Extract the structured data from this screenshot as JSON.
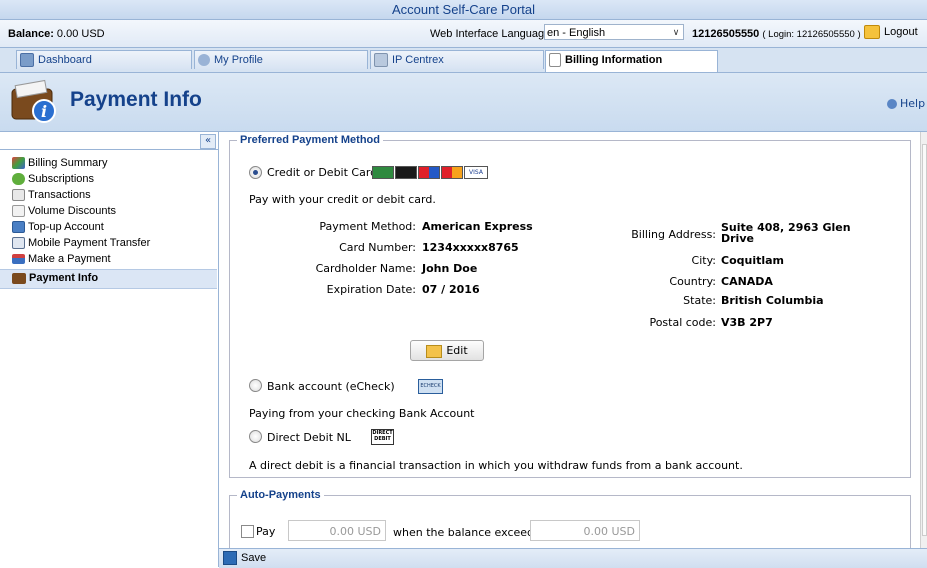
{
  "app": {
    "title": "Account Self-Care Portal"
  },
  "infobar": {
    "balance_label": "Balance:",
    "balance_value": "0.00 USD",
    "language_label": "Web Interface Language:",
    "language_value": "en - English",
    "account_number": "12126505550",
    "login_text": "( Login: 12126505550 )",
    "logout_label": "Logout"
  },
  "tabs": [
    {
      "label": "Dashboard",
      "active": false
    },
    {
      "label": "My Profile",
      "active": false
    },
    {
      "label": "IP Centrex",
      "active": false
    },
    {
      "label": "Billing Information",
      "active": true
    }
  ],
  "page": {
    "title": "Payment Info",
    "help_label": "Help"
  },
  "sidebar": {
    "collapse_glyph": "«",
    "items": [
      {
        "label": "Billing Summary",
        "icon": "chart-icon"
      },
      {
        "label": "Subscriptions",
        "icon": "subscriptions-icon"
      },
      {
        "label": "Transactions",
        "icon": "transactions-icon"
      },
      {
        "label": "Volume Discounts",
        "icon": "discount-icon"
      },
      {
        "label": "Top-up Account",
        "icon": "topup-icon"
      },
      {
        "label": "Mobile Payment Transfer",
        "icon": "mobile-transfer-icon"
      },
      {
        "label": "Make a Payment",
        "icon": "payment-icon"
      },
      {
        "label": "Payment Info",
        "icon": "wallet-icon",
        "selected": true
      }
    ]
  },
  "preferred": {
    "legend": "Preferred Payment Method",
    "credit": {
      "option_label": "Credit or Debit Card",
      "selected": true,
      "description": "Pay with your credit or debit card.",
      "payment_method_label": "Payment Method:",
      "payment_method_value": "American Express",
      "card_number_label": "Card Number:",
      "card_number_value": "1234xxxxx8765",
      "cardholder_label": "Cardholder Name:",
      "cardholder_value": "John Doe",
      "expiration_label": "Expiration Date:",
      "expiration_value": "07 / 2016",
      "billing_address_label": "Billing Address:",
      "billing_address_line1": "Suite 408, 2963 Glen",
      "billing_address_line2": "Drive",
      "city_label": "City:",
      "city_value": "Coquitlam",
      "country_label": "Country:",
      "country_value": "CANADA",
      "state_label": "State:",
      "state_value": "British Columbia",
      "postal_label": "Postal code:",
      "postal_value": "V3B 2P7",
      "edit_label": "Edit",
      "card_logo_visa": "VISA"
    },
    "bank": {
      "option_label": "Bank account (eCheck)",
      "icon_text": "ECHECK",
      "description": "Paying from your checking Bank Account"
    },
    "direct_debit": {
      "option_label": "Direct Debit NL",
      "icon_text_1": "DIRECT",
      "icon_text_2": "DEBIT",
      "description": "A direct debit is a financial transaction in which you withdraw funds from a bank account."
    }
  },
  "auto": {
    "legend": "Auto-Payments",
    "pay_label": "Pay",
    "pay_amount": "0.00 USD",
    "when_label": "when the balance exceeds",
    "threshold_amount": "0.00 USD"
  },
  "footer": {
    "save_label": "Save"
  },
  "colors": {
    "accent": "#15428b",
    "header_bg": "#c9dbef",
    "border": "#99b4d6"
  }
}
